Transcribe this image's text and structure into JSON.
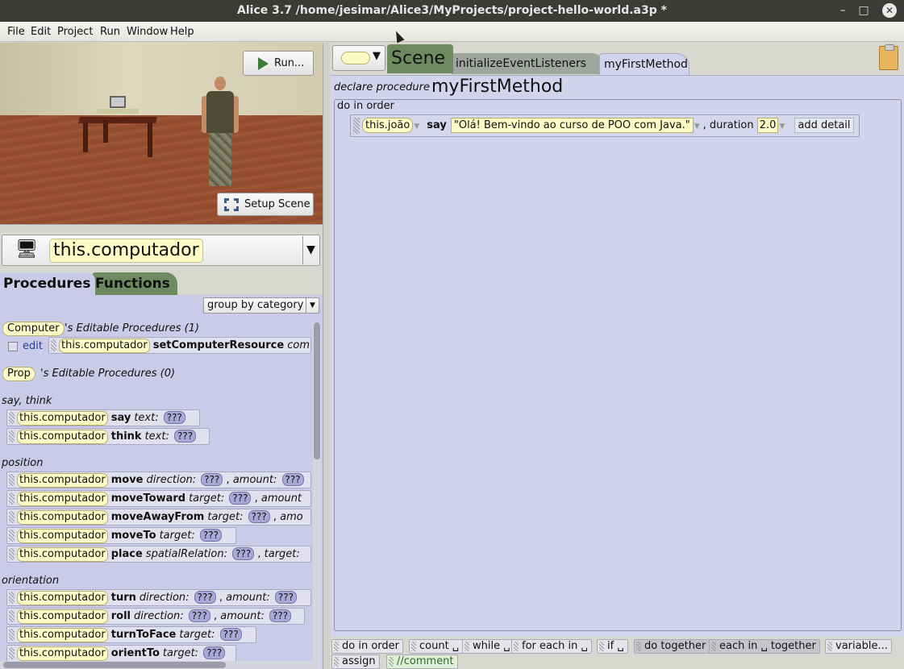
{
  "window": {
    "title": "Alice 3.7 /home/jesimar/Alice3/MyProjects/project-hello-world.a3p *"
  },
  "menu": [
    "File",
    "Edit",
    "Project",
    "Run",
    "Window",
    "Help"
  ],
  "scene": {
    "run_label": "Run...",
    "setup_label": "Setup Scene"
  },
  "instance": {
    "selected": "this.computador"
  },
  "left_tabs": {
    "procedures": "Procedures",
    "functions": "Functions"
  },
  "group_by": "group by category",
  "editable": [
    {
      "type": "Computer",
      "tail": "'s Editable Procedures (1)"
    },
    {
      "type": "Prop",
      "tail": "'s Editable Procedures (0)"
    }
  ],
  "edit_label": "edit",
  "set_resource": {
    "target": "this.computador",
    "name": "setComputerResource",
    "param": "com"
  },
  "categories": {
    "say_think": "say, think",
    "position": "position",
    "orientation": "orientation"
  },
  "procedures": {
    "target": "this.computador",
    "q": "???",
    "say": {
      "name": "say",
      "p1": "text:"
    },
    "think": {
      "name": "think",
      "p1": "text:"
    },
    "move": {
      "name": "move",
      "p1": "direction:",
      "p2": "amount:"
    },
    "moveToward": {
      "name": "moveToward",
      "p1": "target:",
      "p2": "amount"
    },
    "moveAwayFrom": {
      "name": "moveAwayFrom",
      "p1": "target:",
      "p2": "amo"
    },
    "moveTo": {
      "name": "moveTo",
      "p1": "target:"
    },
    "place": {
      "name": "place",
      "p1": "spatialRelation:",
      "p2": "target:"
    },
    "turn": {
      "name": "turn",
      "p1": "direction:",
      "p2": "amount:"
    },
    "roll": {
      "name": "roll",
      "p1": "direction:",
      "p2": "amount:"
    },
    "turnToFace": {
      "name": "turnToFace",
      "p1": "target:"
    },
    "orientTo": {
      "name": "orientTo",
      "p1": "target:"
    }
  },
  "editor_tabs": {
    "scene": "Scene",
    "init": "initializeEventListeners",
    "method": "myFirstMethod"
  },
  "declaration": {
    "label": "declare procedure",
    "name": "myFirstMethod"
  },
  "do_in_order": "do in order",
  "statement": {
    "target": "this.joão",
    "verb": "say",
    "text": "\"Olá! Bem-vindo ao curso de POO com Java.\"",
    "duration_label": "duration",
    "duration": "2.0",
    "add_detail": "add detail"
  },
  "controls": [
    "do in order",
    "count ␣",
    "while ␣",
    "for each in ␣",
    "if ␣",
    "do together",
    "each in ␣ together",
    "variable...",
    "assign",
    "//comment"
  ],
  "colors": {
    "object_pill": "#fffbc6",
    "procedures_bg": "#c9cbe8",
    "functions_tab": "#6e8b60",
    "editor_bg": "#d2d3ec",
    "title_bar": "#3b3b37"
  }
}
